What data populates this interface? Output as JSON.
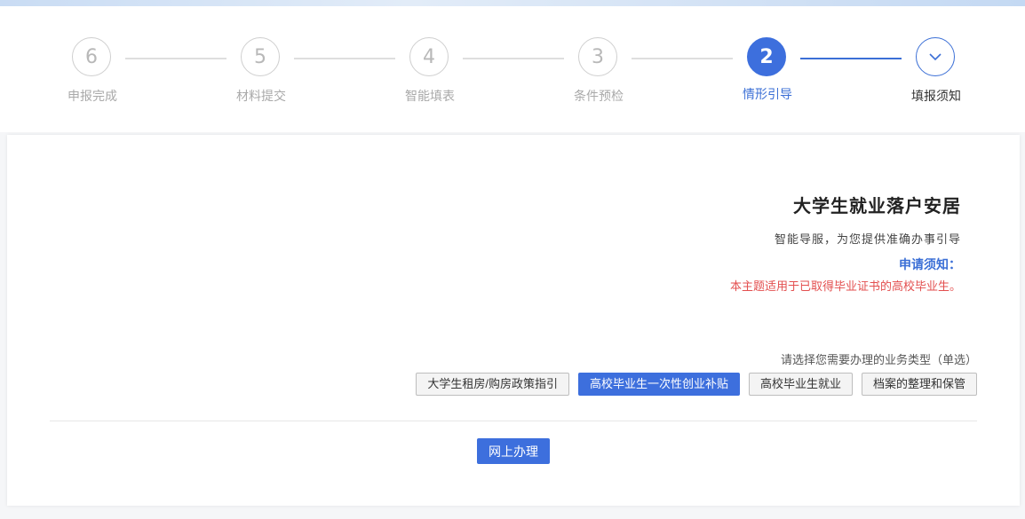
{
  "steps": [
    {
      "number": "✓",
      "label": "填报须知",
      "state": "done"
    },
    {
      "number": "2",
      "label": "情形引导",
      "state": "active"
    },
    {
      "number": "3",
      "label": "条件预检",
      "state": "pending"
    },
    {
      "number": "4",
      "label": "智能填表",
      "state": "pending"
    },
    {
      "number": "5",
      "label": "材料提交",
      "state": "pending"
    },
    {
      "number": "6",
      "label": "申报完成",
      "state": "pending"
    }
  ],
  "guide": {
    "title": "大学生就业落户安居",
    "subtitle": "智能导服，为您提供准确办事引导",
    "notice_heading": "申请须知：",
    "notice_text": "本主题适用于已取得毕业证书的高校毕业生。"
  },
  "selection": {
    "prompt": "请选择您需要办理的业务类型（单选）",
    "options": [
      {
        "label": "档案的整理和保管",
        "selected": false
      },
      {
        "label": "高校毕业生就业",
        "selected": false
      },
      {
        "label": "高校毕业生一次性创业补贴",
        "selected": true
      },
      {
        "label": "大学生租房/购房政策指引",
        "selected": false
      }
    ]
  },
  "actions": {
    "online_label": "网上办理"
  },
  "colors": {
    "primary": "#3d6fdd",
    "notice": "#e34f4f",
    "pending": "#b8b8b8"
  }
}
